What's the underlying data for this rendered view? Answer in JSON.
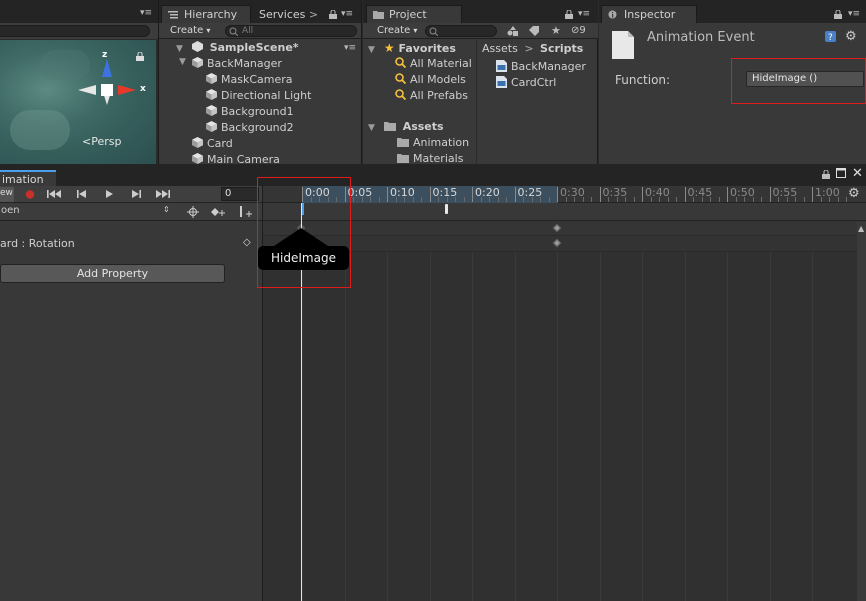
{
  "scene": {
    "axis_z": "z",
    "axis_x": "x",
    "persp_label": "<Persp"
  },
  "hierarchy": {
    "tab_label": "Hierarchy",
    "services_label": "Services",
    "create_label": "Create",
    "search_placeholder": "All",
    "scene_name": "SampleScene*",
    "items": [
      {
        "label": "BackManager"
      },
      {
        "label": "MaskCamera"
      },
      {
        "label": "Directional Light"
      },
      {
        "label": "Background1"
      },
      {
        "label": "Background2"
      },
      {
        "label": "Card"
      },
      {
        "label": "Main Camera"
      }
    ]
  },
  "project": {
    "tab_label": "Project",
    "create_label": "Create",
    "hidden_count": "9",
    "favorites_label": "Favorites",
    "favorites": [
      {
        "label": "All Material"
      },
      {
        "label": "All Models"
      },
      {
        "label": "All Prefabs"
      }
    ],
    "assets_label": "Assets",
    "asset_folders": [
      {
        "label": "Animation"
      },
      {
        "label": "Materials"
      }
    ],
    "breadcrumb": {
      "root": "Assets",
      "sep": ">",
      "current": "Scripts"
    },
    "scripts": [
      {
        "label": "BackManager"
      },
      {
        "label": "CardCtrl"
      }
    ]
  },
  "inspector": {
    "tab_label": "Inspector",
    "title": "Animation Event",
    "function_label": "Function:",
    "function_value": "HideImage ()"
  },
  "animation": {
    "tab_label": "imation",
    "preview_label": "ew",
    "frame_value": "0",
    "clip_label": "oen",
    "property_label": "ard : Rotation",
    "add_property_label": "Add Property",
    "ruler_ticks": [
      {
        "label": "0:00"
      },
      {
        "label": "0:05"
      },
      {
        "label": "0:10"
      },
      {
        "label": "0:15"
      },
      {
        "label": "0:20"
      },
      {
        "label": "0:25"
      },
      {
        "label": "0:30"
      },
      {
        "label": "0:35"
      },
      {
        "label": "0:40"
      },
      {
        "label": "0:45"
      },
      {
        "label": "0:50"
      },
      {
        "label": "0:55"
      },
      {
        "label": "1:00"
      }
    ],
    "event_tooltip": "HideImage"
  },
  "colors": {
    "accent_blue": "#4a9fe8",
    "record_red": "#c8302a",
    "highlight_red": "#e01b1b"
  }
}
